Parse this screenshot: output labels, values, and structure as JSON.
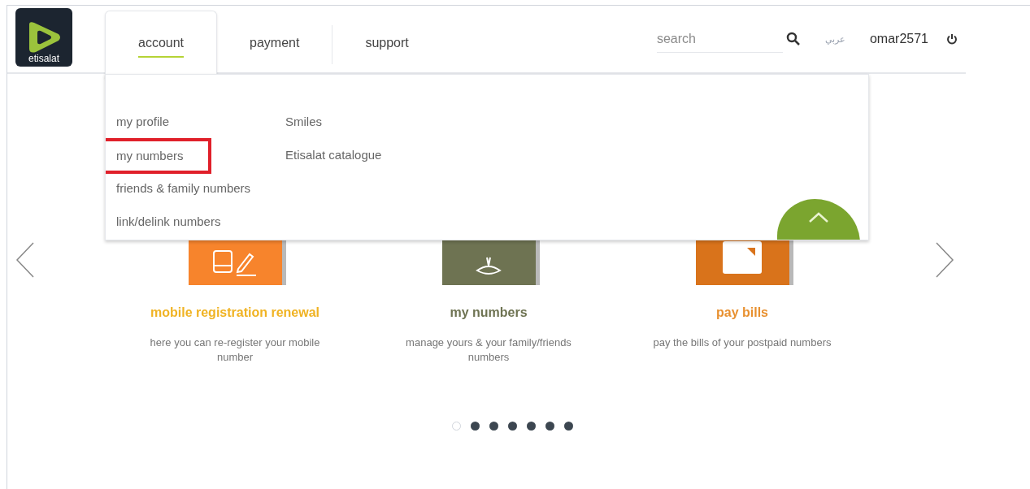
{
  "logo": {
    "text": "etisalat"
  },
  "tabs": [
    {
      "label": "account",
      "selected": true
    },
    {
      "label": "payment",
      "selected": false
    },
    {
      "label": "support",
      "selected": false
    }
  ],
  "search": {
    "placeholder": "search"
  },
  "language": "عربي",
  "user": "omar2571",
  "dropdown": {
    "columns": [
      [
        {
          "label": "my profile",
          "highlighted": false
        },
        {
          "label": "my numbers",
          "highlighted": true
        },
        {
          "label": "friends & family numbers",
          "highlighted": false
        },
        {
          "label": "link/delink numbers",
          "highlighted": false
        }
      ],
      [
        {
          "label": "Smiles",
          "highlighted": false
        },
        {
          "label": "Etisalat catalogue",
          "highlighted": false
        }
      ]
    ]
  },
  "cards": [
    {
      "kind": "phone",
      "title": "mobile registration renewal",
      "description": "here you can re-register your mobile number",
      "color": "#f7842c"
    },
    {
      "kind": "hand",
      "title": "my numbers",
      "description": "manage yours & your family/friends numbers",
      "color": "#6e7352"
    },
    {
      "kind": "bill",
      "title": "pay bills",
      "description": "pay the bills of your postpaid numbers",
      "color": "#d9731b"
    }
  ],
  "dots": [
    {
      "selected": true
    },
    {
      "selected": false
    },
    {
      "selected": false
    },
    {
      "selected": false
    },
    {
      "selected": false
    },
    {
      "selected": false
    },
    {
      "selected": false
    }
  ]
}
